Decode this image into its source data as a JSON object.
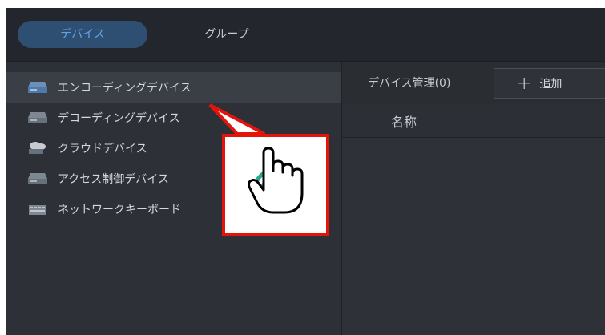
{
  "tabs": [
    {
      "label": "デバイス"
    },
    {
      "label": "グループ"
    }
  ],
  "sidebar": {
    "items": [
      {
        "label": "エンコーディングデバイス",
        "icon": "encoder-device-icon"
      },
      {
        "label": "デコーディングデバイス",
        "icon": "decoder-device-icon"
      },
      {
        "label": "クラウドデバイス",
        "icon": "cloud-device-icon"
      },
      {
        "label": "アクセス制御デバイス",
        "icon": "access-control-device-icon"
      },
      {
        "label": "ネットワークキーボード",
        "icon": "network-keyboard-icon"
      }
    ]
  },
  "main": {
    "title": "デバイス管理(0)",
    "add_button": "追加",
    "columns": [
      "名称"
    ]
  },
  "colors": {
    "accent": "#5fa3e6",
    "callout_border": "#e4140c",
    "click_ring": "#2aa88a"
  }
}
